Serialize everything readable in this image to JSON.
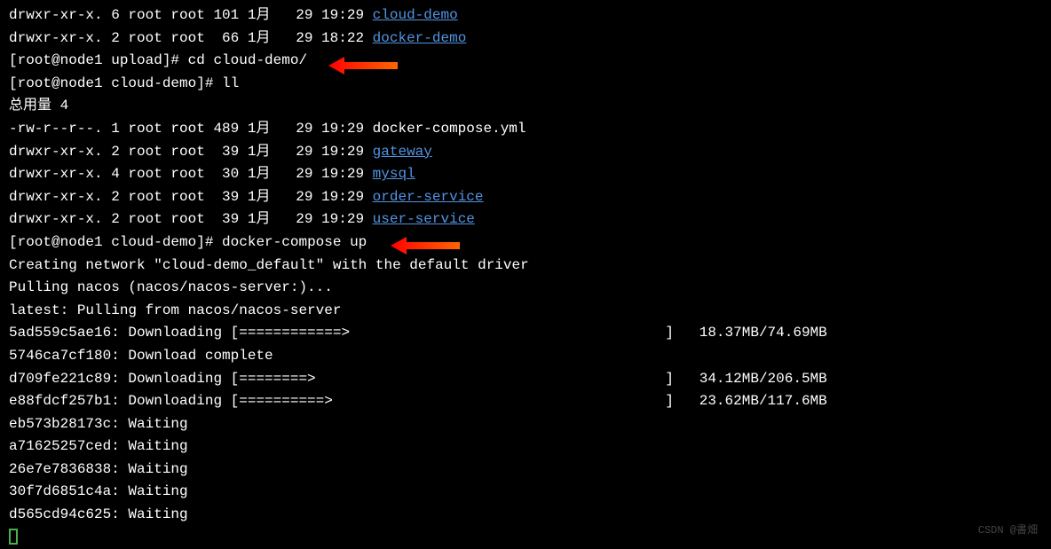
{
  "listing1": [
    {
      "perms": "drwxr-xr-x.",
      "links": "6",
      "owner": "root",
      "group": "root",
      "size": "101",
      "month": "1月",
      "day": " 29",
      "time": "19:29",
      "name": "cloud-demo",
      "isDir": true
    },
    {
      "perms": "drwxr-xr-x.",
      "links": "2",
      "owner": "root",
      "group": "root",
      "size": " 66",
      "month": "1月",
      "day": " 29",
      "time": "18:22",
      "name": "docker-demo",
      "isDir": true
    }
  ],
  "prompt1": "[root@node1 upload]# ",
  "cmd1": "cd cloud-demo/",
  "prompt2": "[root@node1 cloud-demo]# ",
  "cmd2": "ll",
  "total": "总用量 4",
  "listing2": [
    {
      "perms": "-rw-r--r--.",
      "links": "1",
      "owner": "root",
      "group": "root",
      "size": "489",
      "month": "1月",
      "day": " 29",
      "time": "19:29",
      "name": "docker-compose.yml",
      "isDir": false
    },
    {
      "perms": "drwxr-xr-x.",
      "links": "2",
      "owner": "root",
      "group": "root",
      "size": " 39",
      "month": "1月",
      "day": " 29",
      "time": "19:29",
      "name": "gateway",
      "isDir": true
    },
    {
      "perms": "drwxr-xr-x.",
      "links": "4",
      "owner": "root",
      "group": "root",
      "size": " 30",
      "month": "1月",
      "day": " 29",
      "time": "19:29",
      "name": "mysql",
      "isDir": true
    },
    {
      "perms": "drwxr-xr-x.",
      "links": "2",
      "owner": "root",
      "group": "root",
      "size": " 39",
      "month": "1月",
      "day": " 29",
      "time": "19:29",
      "name": "order-service",
      "isDir": true
    },
    {
      "perms": "drwxr-xr-x.",
      "links": "2",
      "owner": "root",
      "group": "root",
      "size": " 39",
      "month": "1月",
      "day": " 29",
      "time": "19:29",
      "name": "user-service",
      "isDir": true
    }
  ],
  "prompt3": "[root@node1 cloud-demo]# ",
  "cmd3": "docker-compose up",
  "output": {
    "network": "Creating network \"cloud-demo_default\" with the default driver",
    "pulling": "Pulling nacos (nacos/nacos-server:)...",
    "latest": "latest: Pulling from nacos/nacos-server"
  },
  "downloads": [
    {
      "hash": "5ad559c5ae16",
      "status": "Downloading",
      "bar": "[============>                                     ]",
      "progress": " 18.37MB/74.69MB"
    },
    {
      "hash": "5746ca7cf180",
      "status": "Download complete",
      "bar": "",
      "progress": ""
    },
    {
      "hash": "d709fe221c89",
      "status": "Downloading",
      "bar": "[========>                                         ]",
      "progress": " 34.12MB/206.5MB"
    },
    {
      "hash": "e88fdcf257b1",
      "status": "Downloading",
      "bar": "[==========>                                       ]",
      "progress": " 23.62MB/117.6MB"
    },
    {
      "hash": "eb573b28173c",
      "status": "Waiting",
      "bar": "",
      "progress": ""
    },
    {
      "hash": "a71625257ced",
      "status": "Waiting",
      "bar": "",
      "progress": ""
    },
    {
      "hash": "26e7e7836838",
      "status": "Waiting",
      "bar": "",
      "progress": ""
    },
    {
      "hash": "30f7d6851c4a",
      "status": "Waiting",
      "bar": "",
      "progress": ""
    },
    {
      "hash": "d565cd94c625",
      "status": "Waiting",
      "bar": "",
      "progress": ""
    }
  ],
  "watermark": "CSDN @書畑"
}
